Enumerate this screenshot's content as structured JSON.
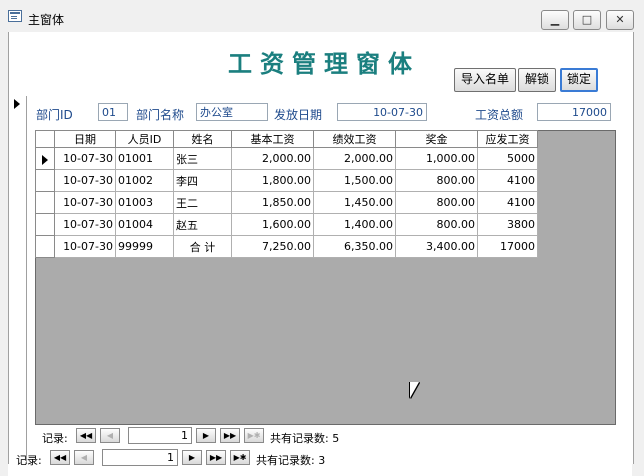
{
  "window": {
    "title": "主窗体",
    "minimize_label": "▁",
    "maximize_label": "□",
    "close_label": "✕"
  },
  "form": {
    "title": "工资管理窗体",
    "buttons": {
      "import": "导入名单",
      "unlock": "解锁",
      "lock": "锁定"
    }
  },
  "header": {
    "dept_id_label": "部门ID",
    "dept_id_value": "01",
    "dept_name_label": "部门名称",
    "dept_name_value": "办公室",
    "pay_date_label": "发放日期",
    "pay_date_value": "10-07-30",
    "total_label": "工资总额",
    "total_value": "17000"
  },
  "table": {
    "columns": [
      "日期",
      "人员ID",
      "姓名",
      "基本工资",
      "绩效工资",
      "奖金",
      "应发工资"
    ],
    "rows": [
      [
        "10-07-30",
        "01001",
        "张三",
        "2,000.00",
        "2,000.00",
        "1,000.00",
        "5000"
      ],
      [
        "10-07-30",
        "01002",
        "李四",
        "1,800.00",
        "1,500.00",
        "800.00",
        "4100"
      ],
      [
        "10-07-30",
        "01003",
        "王二",
        "1,850.00",
        "1,450.00",
        "800.00",
        "4100"
      ],
      [
        "10-07-30",
        "01004",
        "赵五",
        "1,600.00",
        "1,400.00",
        "800.00",
        "3800"
      ],
      [
        "10-07-30",
        "99999",
        "合  计",
        "7,250.00",
        "6,350.00",
        "3,400.00",
        "17000"
      ]
    ]
  },
  "sub_nav": {
    "label": "记录:",
    "position": "1",
    "count_text": "共有记录数: 5"
  },
  "main_nav": {
    "label": "记录:",
    "position": "1",
    "count_text": "共有记录数: 3"
  },
  "nav_icons": {
    "first": "◀◀",
    "prev": "◀",
    "next": "▶",
    "last": "▶▶",
    "new": "▶✱"
  }
}
